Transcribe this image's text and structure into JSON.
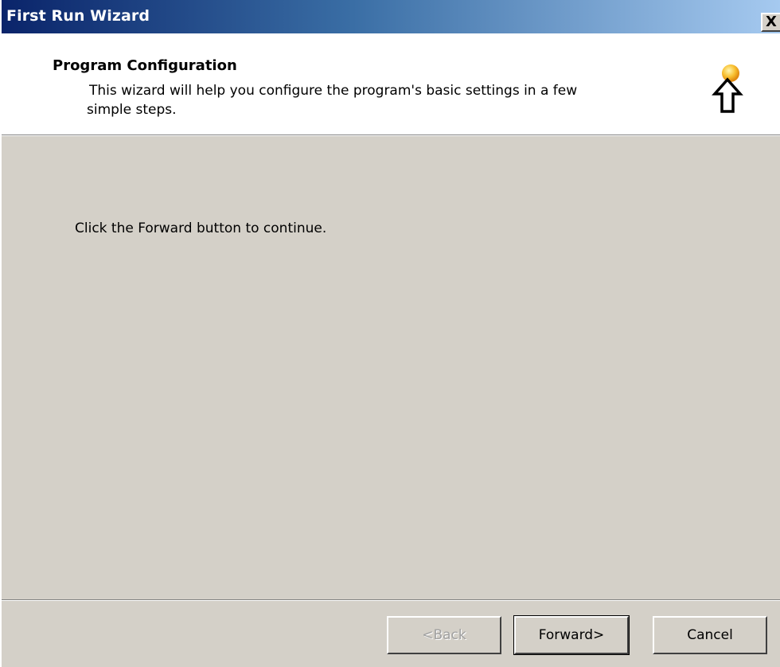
{
  "window": {
    "title": "First Run Wizard",
    "close_glyph": "X"
  },
  "header": {
    "title": "Program Configuration",
    "description_line1": "This wizard will help you configure the program's basic settings in a few",
    "description_line2": "simple steps.",
    "icon": "wizard-lightbulb-arrow-icon"
  },
  "content": {
    "instruction": "Click the Forward button to continue."
  },
  "buttons": {
    "back": "<Back",
    "forward": "Forward>",
    "cancel": "Cancel"
  },
  "colors": {
    "title_start": "#0a246a",
    "title_end": "#a6caf0",
    "face": "#d4d0c8"
  }
}
